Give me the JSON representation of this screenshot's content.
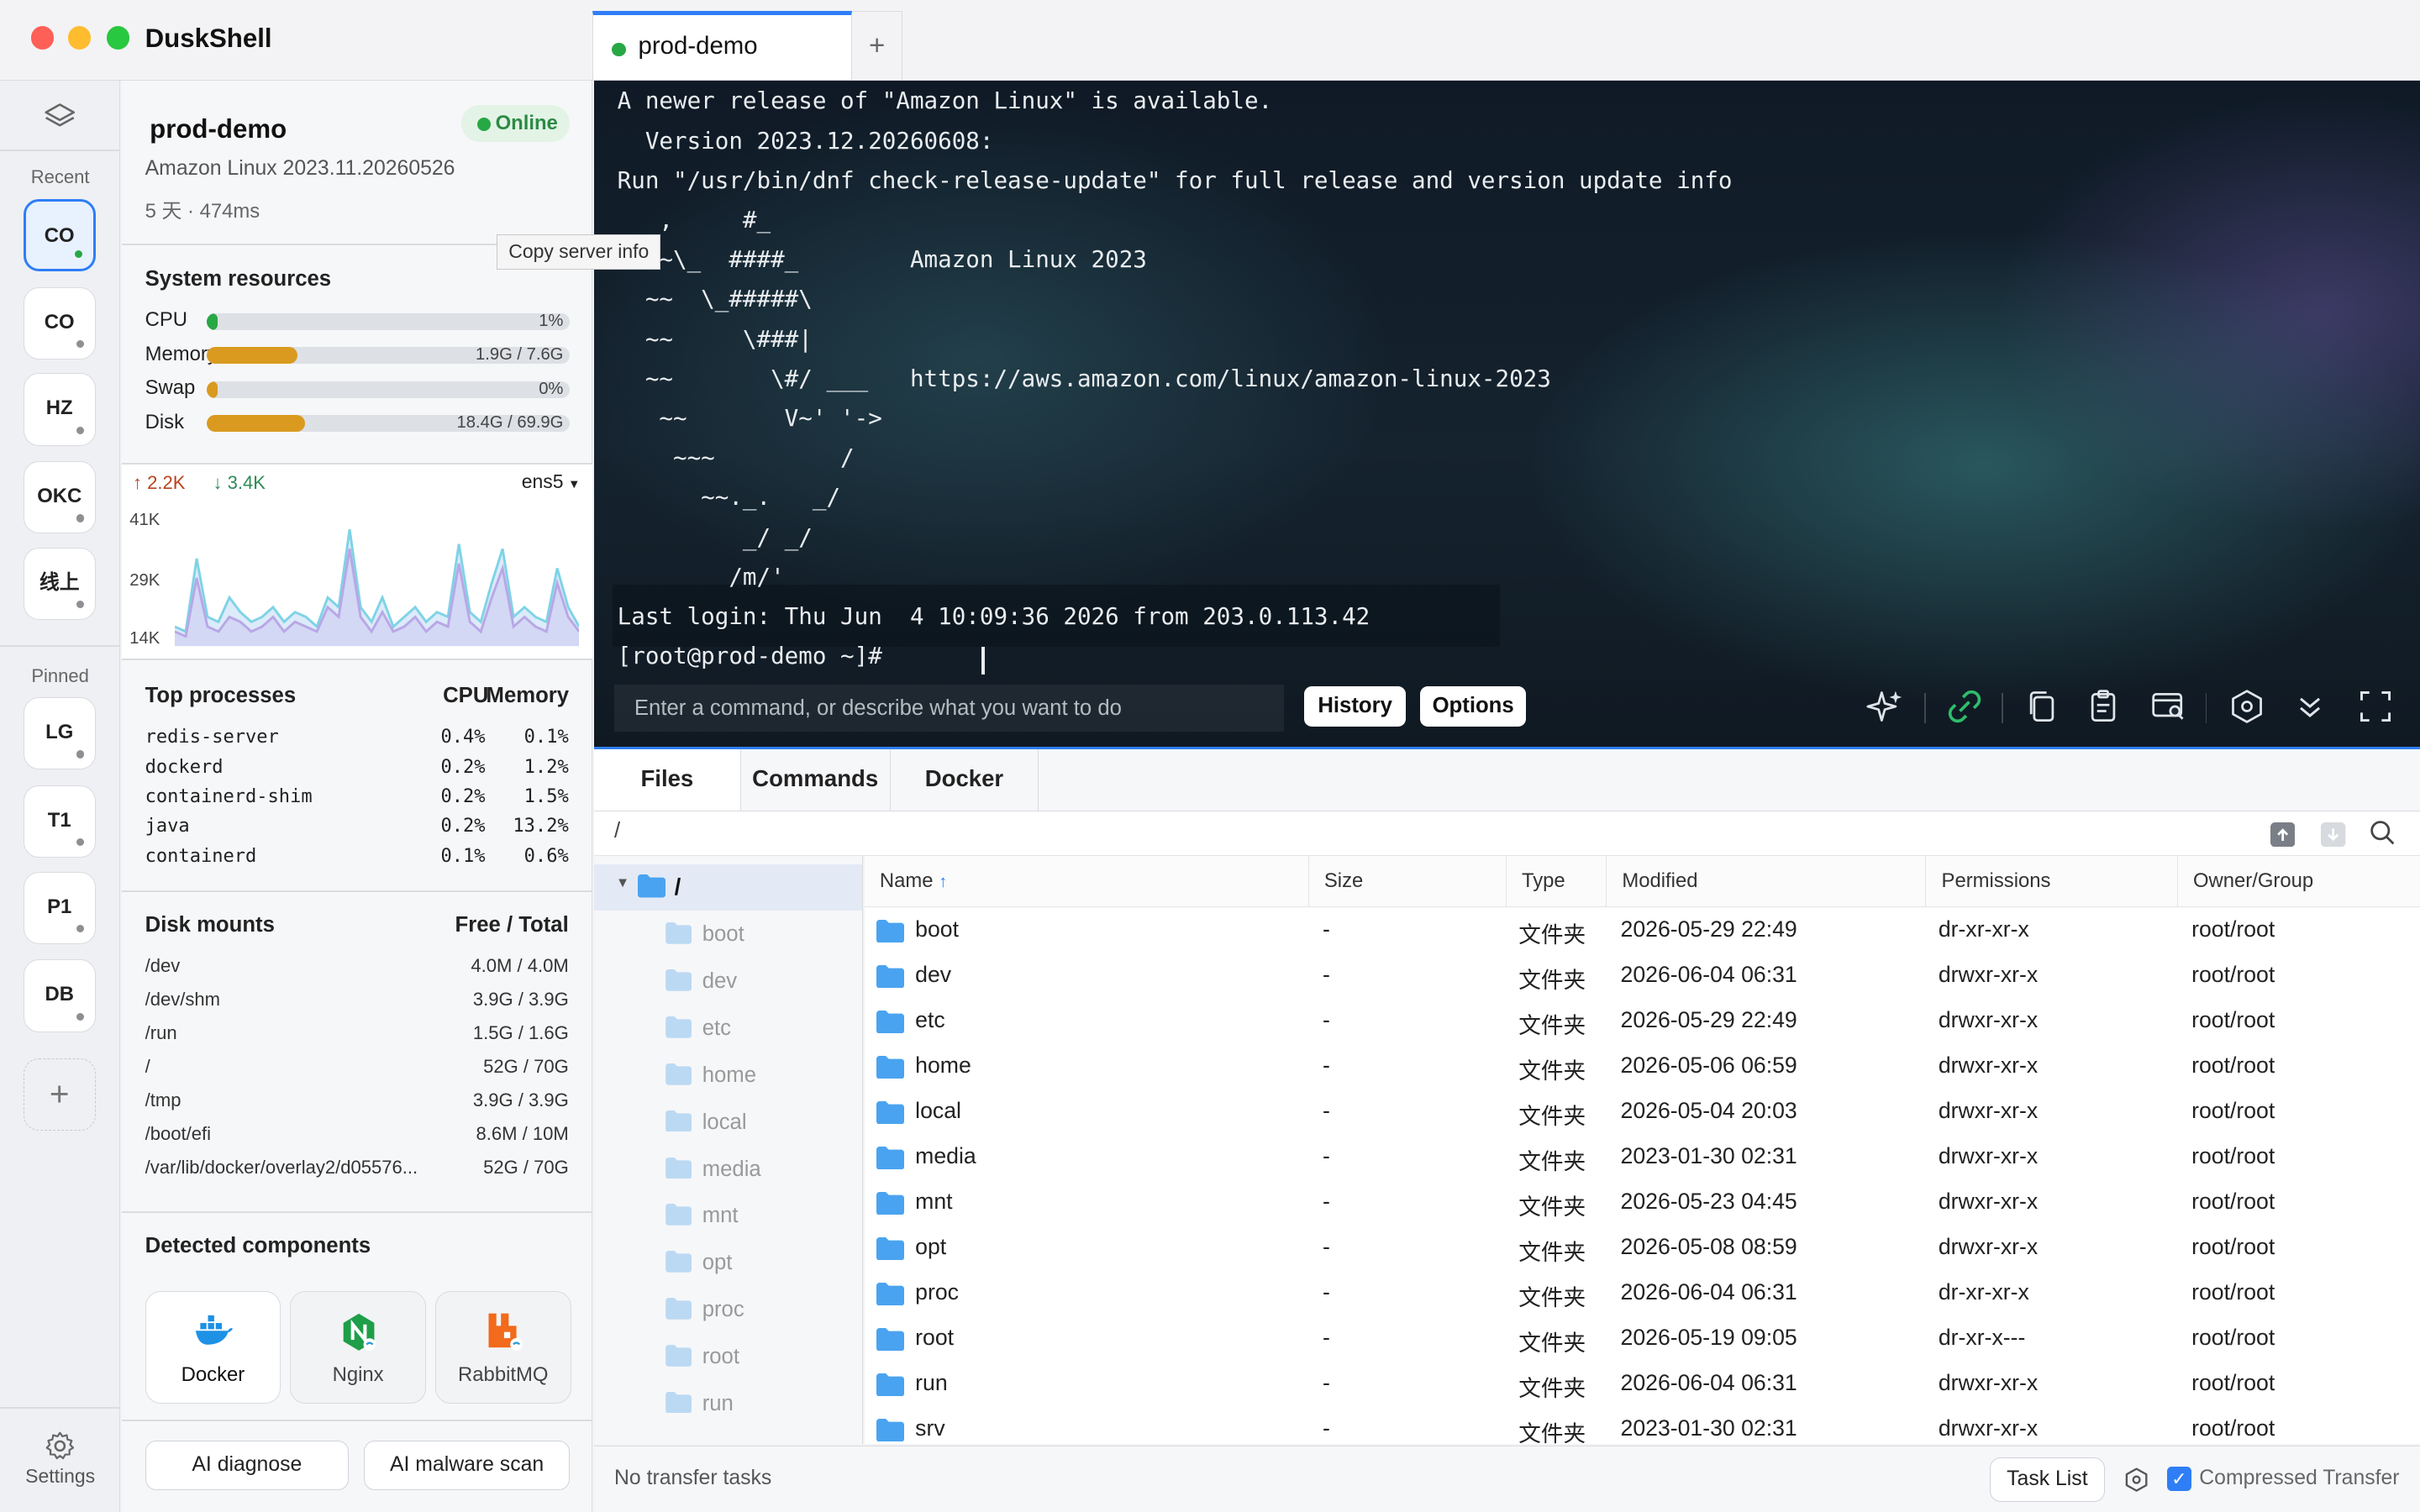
{
  "app": {
    "title": "DuskShell"
  },
  "window": {
    "controls": [
      "close",
      "minimize",
      "zoom"
    ],
    "colors": {
      "close": "#fe5f57",
      "minimize": "#febc2e",
      "zoom": "#28c840"
    }
  },
  "tabs": {
    "active_label": "prod-demo",
    "add_label": "+"
  },
  "rail": {
    "recent_label": "Recent",
    "pinned_label": "Pinned",
    "recent": [
      {
        "label": "CO",
        "active": true
      },
      {
        "label": "CO"
      },
      {
        "label": "HZ"
      },
      {
        "label": "OKC"
      },
      {
        "label": "线上"
      }
    ],
    "pinned": [
      {
        "label": "LG"
      },
      {
        "label": "T1"
      },
      {
        "label": "P1"
      },
      {
        "label": "DB"
      }
    ],
    "add_label": "+",
    "settings_label": "Settings"
  },
  "server": {
    "name": "prod-demo",
    "status": "Online",
    "os": "Amazon Linux 2023.11.20260526",
    "uptime": "5 天 · 474ms",
    "tooltip": "Copy server info"
  },
  "resources": {
    "title": "System resources",
    "items": [
      {
        "label": "CPU",
        "value": "1%",
        "fill_pct": 1
      },
      {
        "label": "Memory",
        "value": "1.9G / 7.6G",
        "fill_pct": 25
      },
      {
        "label": "Swap",
        "value": "0%",
        "fill_pct": 0
      },
      {
        "label": "Disk",
        "value": "18.4G / 69.9G",
        "fill_pct": 27
      }
    ]
  },
  "network": {
    "up": "↑ 2.2K",
    "down": "↓ 3.4K",
    "iface": "ens5",
    "y_ticks": [
      "41K",
      "29K",
      "14K"
    ],
    "colors": {
      "up": "#b8441f",
      "down": "#2e8b57",
      "line_a": "#7fd3e6",
      "line_b": "#b9a7e6"
    }
  },
  "chart_data": {
    "type": "area",
    "title": "",
    "ylabel": "",
    "ylim": [
      14,
      41
    ],
    "y_unit": "K",
    "series": [
      {
        "values": [
          18,
          17,
          32,
          20,
          19,
          24,
          21,
          19,
          20,
          22,
          19,
          21,
          20,
          18,
          24,
          22,
          38,
          22,
          19,
          24,
          18,
          20,
          22,
          19,
          21,
          20,
          35,
          21,
          19,
          27,
          34,
          20,
          22,
          20,
          19,
          30,
          22,
          18
        ]
      },
      {
        "values": [
          17,
          16,
          28,
          18,
          17,
          20,
          19,
          17,
          18,
          20,
          17,
          19,
          18,
          17,
          22,
          20,
          34,
          20,
          17,
          21,
          17,
          18,
          20,
          17,
          19,
          18,
          31,
          19,
          17,
          24,
          30,
          18,
          20,
          18,
          17,
          27,
          20,
          17
        ]
      }
    ]
  },
  "processes": {
    "title": "Top processes",
    "col_cpu": "CPU",
    "col_mem": "Memory",
    "rows": [
      {
        "name": "redis-server",
        "cpu": "0.4%",
        "mem": "0.1%"
      },
      {
        "name": "dockerd",
        "cpu": "0.2%",
        "mem": "1.2%"
      },
      {
        "name": "containerd-shim",
        "cpu": "0.2%",
        "mem": "1.5%"
      },
      {
        "name": "java",
        "cpu": "0.2%",
        "mem": "13.2%"
      },
      {
        "name": "containerd",
        "cpu": "0.1%",
        "mem": "0.6%"
      }
    ]
  },
  "mounts": {
    "title": "Disk mounts",
    "col": "Free / Total",
    "rows": [
      {
        "path": "/dev",
        "value": "4.0M / 4.0M"
      },
      {
        "path": "/dev/shm",
        "value": "3.9G / 3.9G"
      },
      {
        "path": "/run",
        "value": "1.5G / 1.6G"
      },
      {
        "path": "/",
        "value": "52G / 70G"
      },
      {
        "path": "/tmp",
        "value": "3.9G / 3.9G"
      },
      {
        "path": "/boot/efi",
        "value": "8.6M / 10M"
      },
      {
        "path": "/var/lib/docker/overlay2/d05576...",
        "value": "52G / 70G"
      }
    ]
  },
  "components": {
    "title": "Detected components",
    "items": [
      {
        "label": "Docker",
        "icon": "docker-icon"
      },
      {
        "label": "Nginx",
        "icon": "nginx-icon"
      },
      {
        "label": "RabbitMQ",
        "icon": "rabbitmq-icon"
      }
    ]
  },
  "actions": {
    "diagnose": "AI diagnose",
    "malware": "AI malware scan"
  },
  "terminal": {
    "lines": [
      "A newer release of \"Amazon Linux\" is available.",
      "  Version 2023.12.20260608:",
      "Run \"/usr/bin/dnf check-release-update\" for full release and version update info",
      "   ,     #_",
      "   ~\\_  ####_        Amazon Linux 2023",
      "  ~~  \\_#####\\",
      "  ~~     \\###|",
      "  ~~       \\#/ ___   https://aws.amazon.com/linux/amazon-linux-2023",
      "   ~~       V~' '->",
      "    ~~~         /",
      "      ~~._.   _/",
      "         _/ _/",
      "        /m/'",
      "Last login: Thu Jun  4 10:09:36 2026 from 203.0.113.42",
      "[root@prod-demo ~]#"
    ],
    "command_placeholder": "Enter a command, or describe what you want to do",
    "history_label": "History",
    "options_label": "Options"
  },
  "panel_tabs": [
    {
      "label": "Files",
      "active": true
    },
    {
      "label": "Commands"
    },
    {
      "label": "Docker"
    }
  ],
  "files": {
    "path": "/",
    "tree_root": "/",
    "tree": [
      "boot",
      "dev",
      "etc",
      "home",
      "local",
      "media",
      "mnt",
      "opt",
      "proc",
      "root",
      "run"
    ],
    "columns": {
      "name": "Name",
      "sort": "↑",
      "size": "Size",
      "type": "Type",
      "modified": "Modified",
      "permissions": "Permissions",
      "owner": "Owner/Group"
    },
    "rows": [
      {
        "name": "boot",
        "size": "-",
        "type": "文件夹",
        "modified": "2026-05-29 22:49",
        "perm": "dr-xr-xr-x",
        "owner": "root/root"
      },
      {
        "name": "dev",
        "size": "-",
        "type": "文件夹",
        "modified": "2026-06-04 06:31",
        "perm": "drwxr-xr-x",
        "owner": "root/root"
      },
      {
        "name": "etc",
        "size": "-",
        "type": "文件夹",
        "modified": "2026-05-29 22:49",
        "perm": "drwxr-xr-x",
        "owner": "root/root"
      },
      {
        "name": "home",
        "size": "-",
        "type": "文件夹",
        "modified": "2026-05-06 06:59",
        "perm": "drwxr-xr-x",
        "owner": "root/root"
      },
      {
        "name": "local",
        "size": "-",
        "type": "文件夹",
        "modified": "2026-05-04 20:03",
        "perm": "drwxr-xr-x",
        "owner": "root/root"
      },
      {
        "name": "media",
        "size": "-",
        "type": "文件夹",
        "modified": "2023-01-30 02:31",
        "perm": "drwxr-xr-x",
        "owner": "root/root"
      },
      {
        "name": "mnt",
        "size": "-",
        "type": "文件夹",
        "modified": "2026-05-23 04:45",
        "perm": "drwxr-xr-x",
        "owner": "root/root"
      },
      {
        "name": "opt",
        "size": "-",
        "type": "文件夹",
        "modified": "2026-05-08 08:59",
        "perm": "drwxr-xr-x",
        "owner": "root/root"
      },
      {
        "name": "proc",
        "size": "-",
        "type": "文件夹",
        "modified": "2026-06-04 06:31",
        "perm": "dr-xr-xr-x",
        "owner": "root/root"
      },
      {
        "name": "root",
        "size": "-",
        "type": "文件夹",
        "modified": "2026-05-19 09:05",
        "perm": "dr-xr-x---",
        "owner": "root/root"
      },
      {
        "name": "run",
        "size": "-",
        "type": "文件夹",
        "modified": "2026-06-04 06:31",
        "perm": "drwxr-xr-x",
        "owner": "root/root"
      },
      {
        "name": "srv",
        "size": "-",
        "type": "文件夹",
        "modified": "2023-01-30 02:31",
        "perm": "drwxr-xr-x",
        "owner": "root/root"
      }
    ]
  },
  "status": {
    "transfers": "No transfer tasks",
    "task_list": "Task List",
    "compressed": "Compressed Transfer",
    "compressed_checked": true
  },
  "colors": {
    "accent": "#2f7ef6",
    "online": "#28a745",
    "bar": "#d99a1f",
    "folder": "#4aa3f0"
  }
}
